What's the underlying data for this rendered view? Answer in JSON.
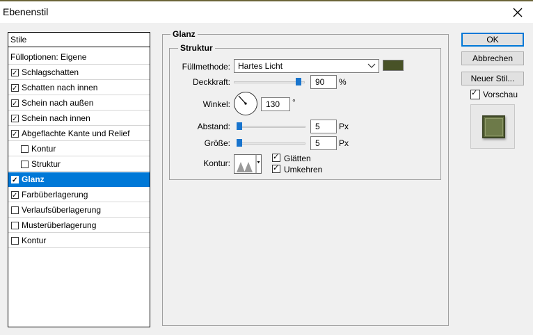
{
  "window": {
    "title": "Ebenenstil"
  },
  "styles_panel": {
    "items": [
      {
        "label": "Stile",
        "checkbox": false,
        "checked": false,
        "indent": 0,
        "selected": false
      },
      {
        "label": "Fülloptionen: Eigene",
        "checkbox": false,
        "checked": false,
        "indent": 0,
        "selected": false
      },
      {
        "label": "Schlagschatten",
        "checkbox": true,
        "checked": true,
        "indent": 0,
        "selected": false
      },
      {
        "label": "Schatten nach innen",
        "checkbox": true,
        "checked": true,
        "indent": 0,
        "selected": false
      },
      {
        "label": "Schein nach außen",
        "checkbox": true,
        "checked": true,
        "indent": 0,
        "selected": false
      },
      {
        "label": "Schein nach innen",
        "checkbox": true,
        "checked": true,
        "indent": 0,
        "selected": false
      },
      {
        "label": "Abgeflachte Kante und Relief",
        "checkbox": true,
        "checked": true,
        "indent": 0,
        "selected": false
      },
      {
        "label": "Kontur",
        "checkbox": true,
        "checked": false,
        "indent": 1,
        "selected": false
      },
      {
        "label": "Struktur",
        "checkbox": true,
        "checked": false,
        "indent": 1,
        "selected": false
      },
      {
        "label": "Glanz",
        "checkbox": true,
        "checked": true,
        "indent": 0,
        "selected": true
      },
      {
        "label": "Farbüberlagerung",
        "checkbox": true,
        "checked": true,
        "indent": 0,
        "selected": false
      },
      {
        "label": "Verlaufsüberlagerung",
        "checkbox": true,
        "checked": false,
        "indent": 0,
        "selected": false
      },
      {
        "label": "Musterüberlagerung",
        "checkbox": true,
        "checked": false,
        "indent": 0,
        "selected": false
      },
      {
        "label": "Kontur",
        "checkbox": true,
        "checked": false,
        "indent": 0,
        "selected": false
      }
    ]
  },
  "glanz": {
    "group_title": "Glanz",
    "structure_title": "Struktur",
    "blend_mode_label": "Füllmethode:",
    "blend_mode_value": "Hartes Licht",
    "color": "#485227",
    "opacity_label": "Deckkraft:",
    "opacity_value": "90",
    "opacity_unit": "%",
    "angle_label": "Winkel:",
    "angle_value": "130",
    "angle_unit": "°",
    "distance_label": "Abstand:",
    "distance_value": "5",
    "distance_unit": "Px",
    "size_label": "Größe:",
    "size_value": "5",
    "size_unit": "Px",
    "contour_label": "Kontur:",
    "antialias_label": "Glätten",
    "antialias_checked": true,
    "invert_label": "Umkehren",
    "invert_checked": true
  },
  "buttons": {
    "ok": "OK",
    "cancel": "Abbrechen",
    "new_style": "Neuer Stil...",
    "preview_label": "Vorschau",
    "preview_checked": true
  },
  "icons": {
    "close": "close-icon",
    "dropdown": "chevron-down-icon",
    "dial": "angle-dial-icon",
    "contour": "contour-curve-icon"
  }
}
